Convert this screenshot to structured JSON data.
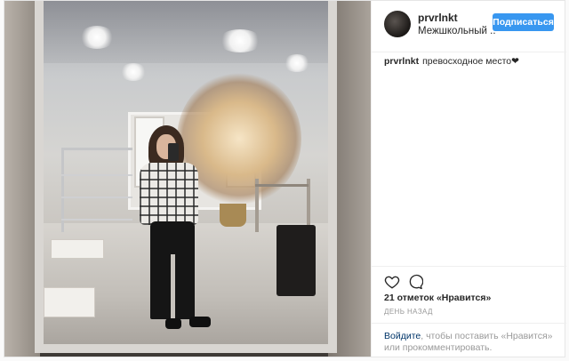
{
  "post": {
    "username": "prvrlnkt",
    "location": "Межшкольный ...",
    "follow_label": "Подписаться",
    "caption_user": "prvrlnkt",
    "caption_text": "превосходное место❤",
    "likes": "21 отметок «Нравится»",
    "timestamp": "день назад",
    "login_link": "Войдите",
    "login_text": ", чтобы поставить «Нравится» или прокомментировать."
  },
  "icons": {
    "like": "heart-icon",
    "comment": "comment-icon"
  },
  "colors": {
    "accent": "#3897f0",
    "link": "#003569",
    "muted": "#999999",
    "text": "#262626"
  }
}
